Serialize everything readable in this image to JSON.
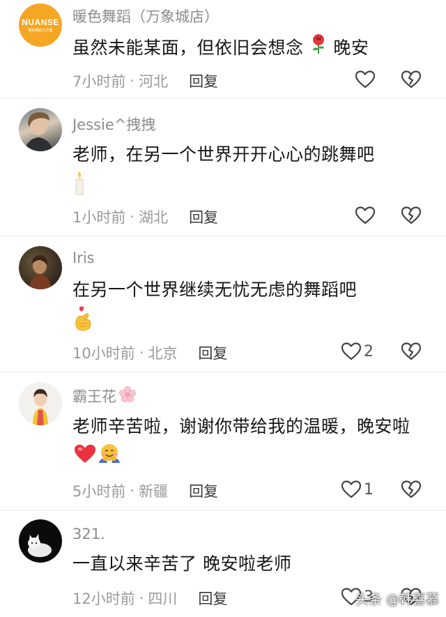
{
  "comments": [
    {
      "name": "暖色舞蹈（万象城店）",
      "avatar_text": "NUANSE",
      "avatar_sub": "暖色舞蹈工作室",
      "text": "虽然未能某面，但依旧会想念",
      "text_tail": "晚安",
      "time": "7小时前",
      "location": "河北",
      "reply": "回复",
      "likes": ""
    },
    {
      "name": "Jessie^拽拽",
      "text": "老师，在另一个世界开开心心的跳舞吧",
      "time": "1小时前",
      "location": "湖北",
      "reply": "回复",
      "likes": ""
    },
    {
      "name": "Iris",
      "text": "在另一个世界继续无忧无虑的舞蹈吧",
      "time": "10小时前",
      "location": "北京",
      "reply": "回复",
      "likes": "2"
    },
    {
      "name": "霸王花",
      "text": "老师辛苦啦，谢谢你带给我的温暖，晚安啦",
      "time": "5小时前",
      "location": "新疆",
      "reply": "回复",
      "likes": "1"
    },
    {
      "name": "321.",
      "text": "一直以来辛苦了  晚安啦老师",
      "time": "12小时前",
      "location": "四川",
      "reply": "回复",
      "likes": "3"
    }
  ],
  "separator": "·",
  "watermark": "头条 @韩喜慕",
  "colors": {
    "brand_orange": "#f5a623",
    "heart_red": "#e8333e"
  }
}
